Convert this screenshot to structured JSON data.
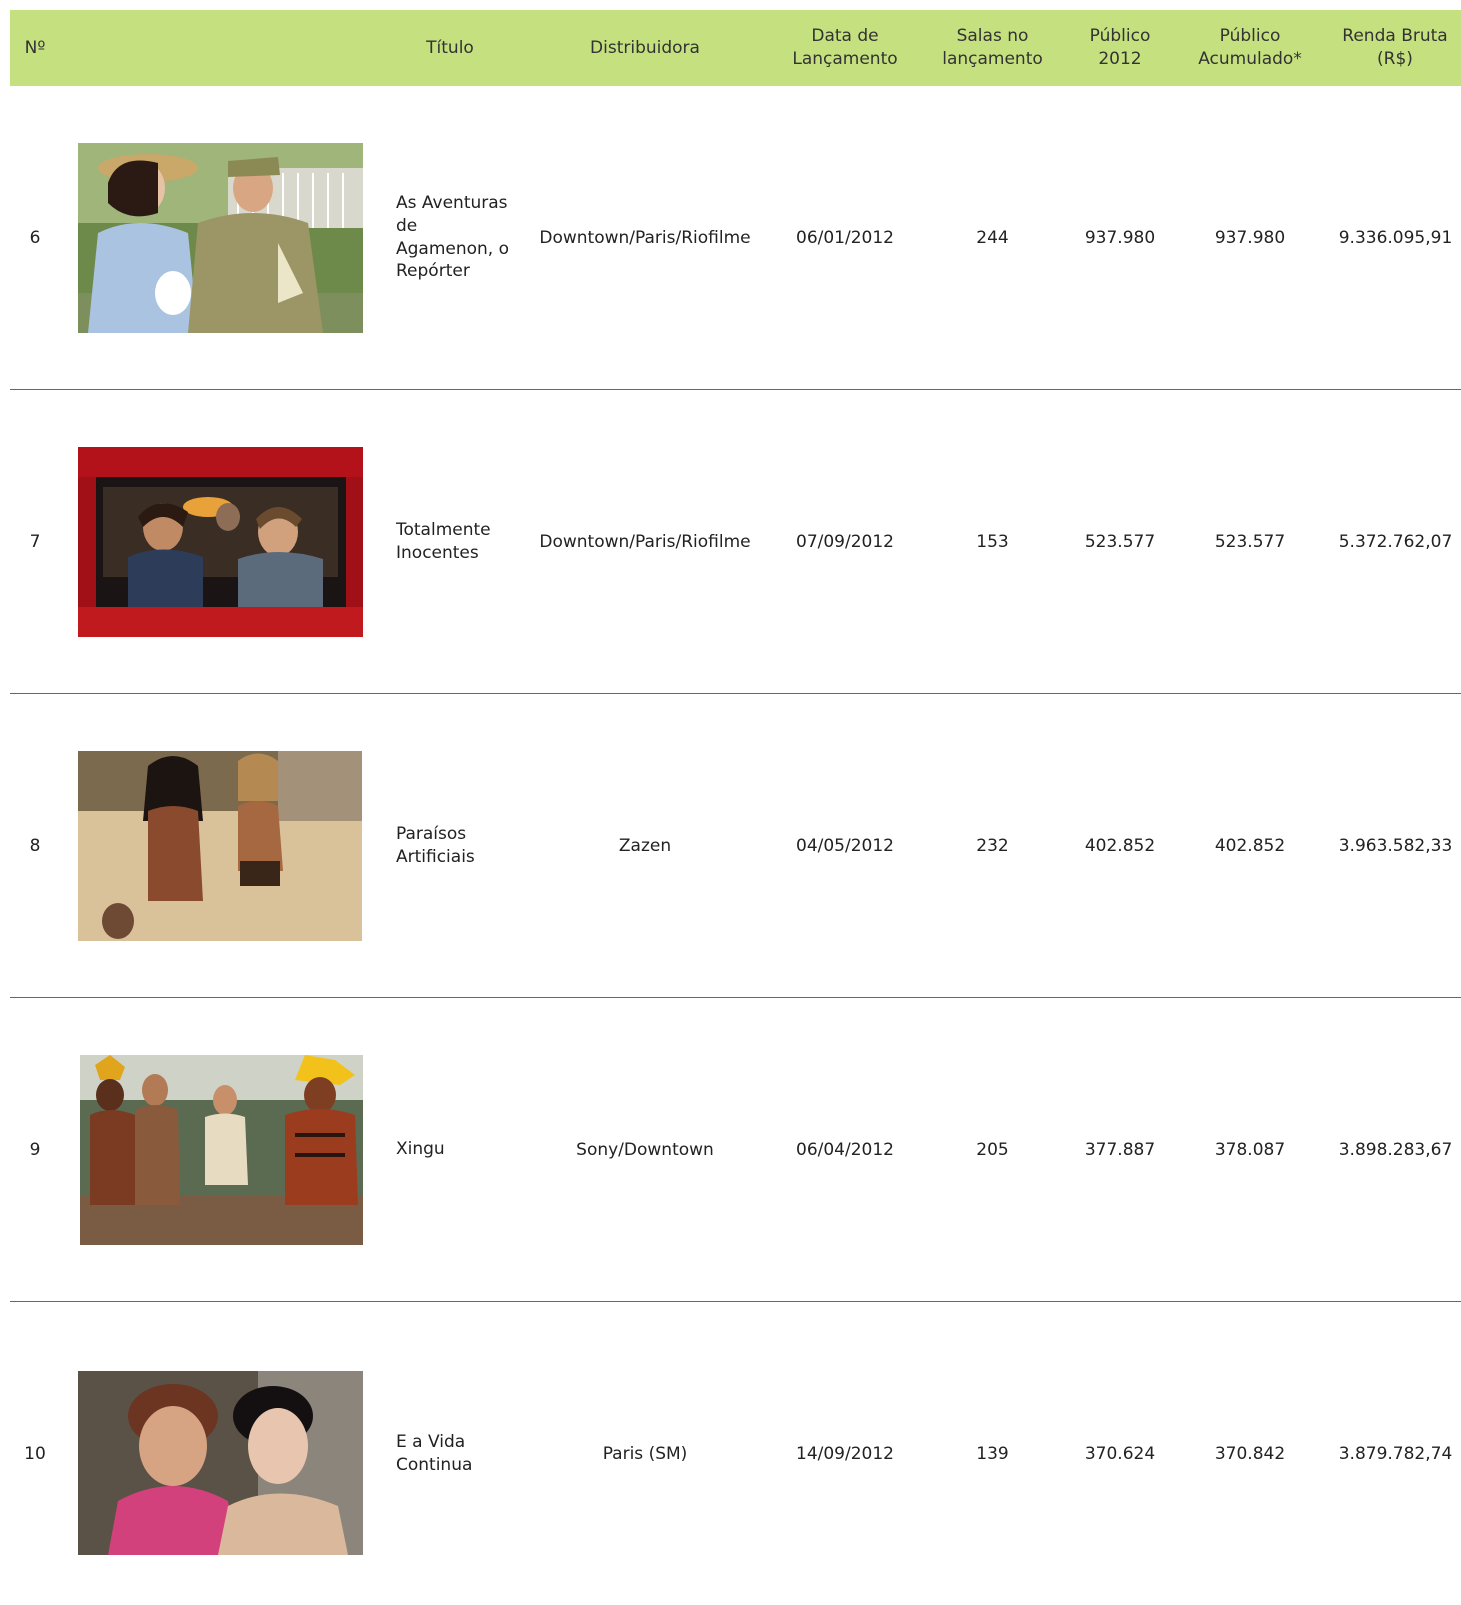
{
  "header": {
    "num": "Nº",
    "title": "Título",
    "distributor": "Distribuidora",
    "release_date": "Data de Lançamento",
    "screens": "Salas no lançamento",
    "audience_2012": "Público 2012",
    "audience_total": "Público Acumulado*",
    "gross": "Renda Bruta (R$)"
  },
  "colors": {
    "header_bg": "#c5e07f",
    "divider": "#5d7a1e"
  },
  "rows": [
    {
      "num": "6",
      "title": "As Aventuras de Agamenon, o Repórter",
      "distributor": "Downtown/Paris/Riofilme",
      "release_date": "06/01/2012",
      "screens": "244",
      "audience_2012": "937.980",
      "audience_total": "937.980",
      "gross": "9.336.095,91"
    },
    {
      "num": "7",
      "title": "Totalmente Inocentes",
      "distributor": "Downtown/Paris/Riofilme",
      "release_date": "07/09/2012",
      "screens": "153",
      "audience_2012": "523.577",
      "audience_total": "523.577",
      "gross": "5.372.762,07"
    },
    {
      "num": "8",
      "title": "Paraísos Artificiais",
      "distributor": "Zazen",
      "release_date": "04/05/2012",
      "screens": "232",
      "audience_2012": "402.852",
      "audience_total": "402.852",
      "gross": "3.963.582,33"
    },
    {
      "num": "9",
      "title": "Xingu",
      "distributor": "Sony/Downtown",
      "release_date": "06/04/2012",
      "screens": "205",
      "audience_2012": "377.887",
      "audience_total": "378.087",
      "gross": "3.898.283,67"
    },
    {
      "num": "10",
      "title": "E a Vida Continua",
      "distributor": "Paris (SM)",
      "release_date": "14/09/2012",
      "screens": "139",
      "audience_2012": "370.624",
      "audience_total": "370.842",
      "gross": "3.879.782,74"
    }
  ]
}
